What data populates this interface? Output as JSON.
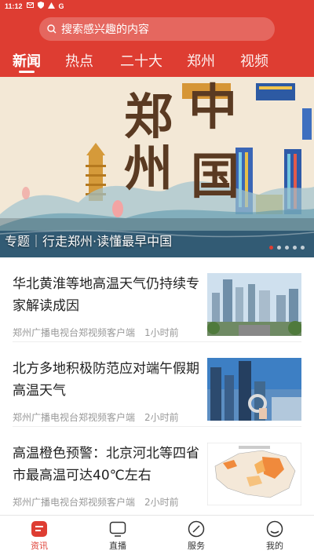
{
  "status_bar": {
    "time": "11:12",
    "icons": [
      "mail-icon",
      "shield-icon",
      "warning-icon",
      "google-icon"
    ]
  },
  "search": {
    "placeholder": "搜索感兴趣的内容",
    "icon": "search-icon"
  },
  "tabs": [
    {
      "label": "新闻",
      "active": true
    },
    {
      "label": "热点",
      "active": false
    },
    {
      "label": "二十大",
      "active": false
    },
    {
      "label": "郑州",
      "active": false
    },
    {
      "label": "视频",
      "active": false
    }
  ],
  "banner": {
    "big_text_left": [
      "郑",
      "州"
    ],
    "big_text_right": [
      "中",
      "国"
    ],
    "caption": "专题｜行走郑州·读懂最早中国",
    "page_count": 5,
    "active_index": 0
  },
  "news": [
    {
      "title": "华北黄淮等地高温天气仍持续专家解读成因",
      "source": "郑州广播电视台郑视频客户端",
      "time": "1小时前"
    },
    {
      "title": "北方多地积极防范应对端午假期高温天气",
      "source": "郑州广播电视台郑视频客户端",
      "time": "2小时前"
    },
    {
      "title": "高温橙色预警：北京河北等四省市最高温可达40℃左右",
      "source": "郑州广播电视台郑视频客户端",
      "time": "2小时前"
    }
  ],
  "bottom_nav": [
    {
      "label": "资讯",
      "icon": "news-icon",
      "active": true
    },
    {
      "label": "直播",
      "icon": "tv-icon",
      "active": false
    },
    {
      "label": "服务",
      "icon": "compass-icon",
      "active": false
    },
    {
      "label": "我的",
      "icon": "profile-icon",
      "active": false
    }
  ],
  "colors": {
    "brand_red": "#de3d32",
    "text": "#222222",
    "meta": "#999999"
  }
}
